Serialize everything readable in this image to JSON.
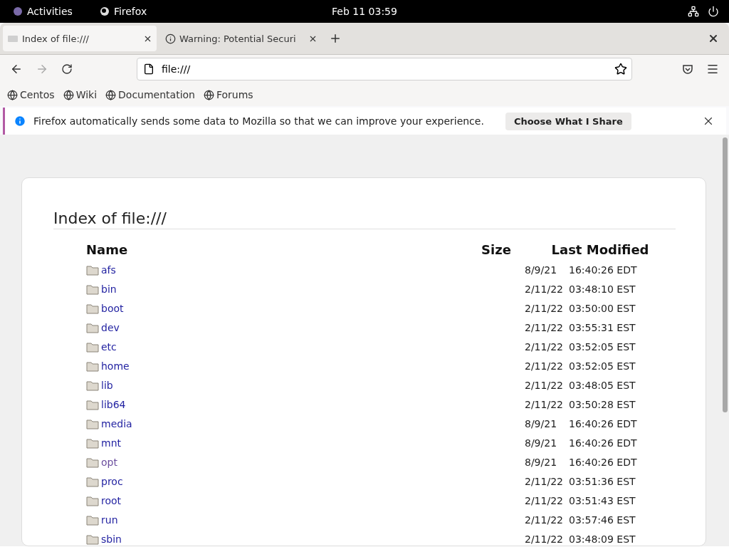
{
  "topbar": {
    "activities": "Activities",
    "app": "Firefox",
    "clock": "Feb 11  03:59"
  },
  "tabs": [
    {
      "title": "Index of file:///",
      "selected": true,
      "kind": "page"
    },
    {
      "title": "Warning: Potential Securi",
      "selected": false,
      "kind": "info"
    }
  ],
  "address": {
    "value": "file:///"
  },
  "bookmarks": [
    "Centos",
    "Wiki",
    "Documentation",
    "Forums"
  ],
  "notification": {
    "message": "Firefox automatically sends some data to Mozilla so that we can improve your experience.",
    "button": "Choose What I Share"
  },
  "page": {
    "heading": "Index of file:///",
    "columns": [
      "Name",
      "Size",
      "Last Modified"
    ],
    "rows": [
      {
        "name": "afs",
        "date": "8/9/21",
        "time": "16:40:26 EDT",
        "visited": false
      },
      {
        "name": "bin",
        "date": "2/11/22",
        "time": "03:48:10 EST",
        "visited": false
      },
      {
        "name": "boot",
        "date": "2/11/22",
        "time": "03:50:00 EST",
        "visited": false
      },
      {
        "name": "dev",
        "date": "2/11/22",
        "time": "03:55:31 EST",
        "visited": false
      },
      {
        "name": "etc",
        "date": "2/11/22",
        "time": "03:52:05 EST",
        "visited": false
      },
      {
        "name": "home",
        "date": "2/11/22",
        "time": "03:52:05 EST",
        "visited": false
      },
      {
        "name": "lib",
        "date": "2/11/22",
        "time": "03:48:05 EST",
        "visited": false
      },
      {
        "name": "lib64",
        "date": "2/11/22",
        "time": "03:50:28 EST",
        "visited": false
      },
      {
        "name": "media",
        "date": "8/9/21",
        "time": "16:40:26 EDT",
        "visited": false
      },
      {
        "name": "mnt",
        "date": "8/9/21",
        "time": "16:40:26 EDT",
        "visited": false
      },
      {
        "name": "opt",
        "date": "8/9/21",
        "time": "16:40:26 EDT",
        "visited": true
      },
      {
        "name": "proc",
        "date": "2/11/22",
        "time": "03:51:36 EST",
        "visited": false
      },
      {
        "name": "root",
        "date": "2/11/22",
        "time": "03:51:43 EST",
        "visited": false
      },
      {
        "name": "run",
        "date": "2/11/22",
        "time": "03:57:46 EST",
        "visited": false
      },
      {
        "name": "sbin",
        "date": "2/11/22",
        "time": "03:48:09 EST",
        "visited": false
      }
    ]
  }
}
